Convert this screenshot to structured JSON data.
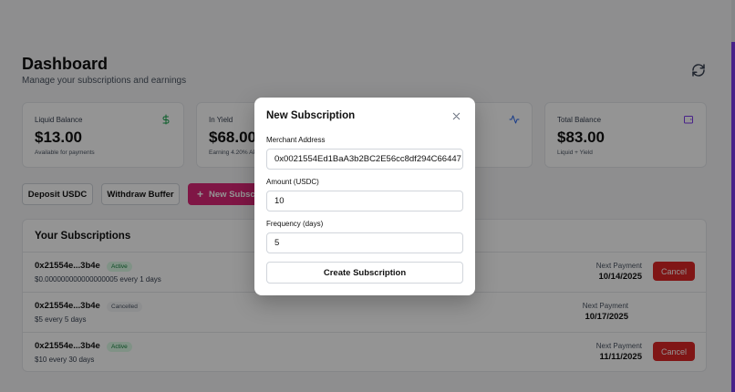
{
  "header": {
    "title": "Dashboard",
    "subtitle": "Manage your subscriptions and earnings"
  },
  "cards": [
    {
      "label": "Liquid Balance",
      "value": "$13.00",
      "sub": "Available for payments",
      "icon": "dollar-icon",
      "icon_color": "#16a34a"
    },
    {
      "label": "In Yield",
      "value": "$68.00",
      "sub": "Earning 4.20% APY",
      "icon": "trend-icon",
      "icon_color": "#2563eb"
    },
    {
      "label": "",
      "value": "",
      "sub": "",
      "icon": "activity-icon",
      "icon_color": "#2563eb"
    },
    {
      "label": "Total Balance",
      "value": "$83.00",
      "sub": "Liquid + Yield",
      "icon": "wallet-icon",
      "icon_color": "#7c3aed"
    }
  ],
  "actions": {
    "deposit": "Deposit USDC",
    "withdraw": "Withdraw Buffer",
    "new_sub": "New Subscr"
  },
  "subscriptions": {
    "heading": "Your Subscriptions",
    "next_payment_label": "Next Payment",
    "cancel_label": "Cancel",
    "rows": [
      {
        "address": "0x21554e...3b4e",
        "status": "Active",
        "desc": "$0.000000000000000005 every 1 days",
        "next": "10/14/2025"
      },
      {
        "address": "0x21554e...3b4e",
        "status": "Cancelled",
        "desc": "$5 every 5 days",
        "next": "10/17/2025"
      },
      {
        "address": "0x21554e...3b4e",
        "status": "Active",
        "desc": "$10 every 30 days",
        "next": "11/11/2025"
      }
    ]
  },
  "modal": {
    "title": "New Subscription",
    "merchant_label": "Merchant Address",
    "merchant_value": "0x0021554Ed1BaA3b2BC2E56cc8df294C66447",
    "amount_label": "Amount (USDC)",
    "amount_value": "10",
    "frequency_label": "Frequency (days)",
    "frequency_value": "5",
    "submit_label": "Create Subscription"
  },
  "colors": {
    "accent_pink": "#db2777",
    "cancel_red": "#dc2626",
    "active_green": "#15803d",
    "side_accent": "#7c3aed"
  }
}
